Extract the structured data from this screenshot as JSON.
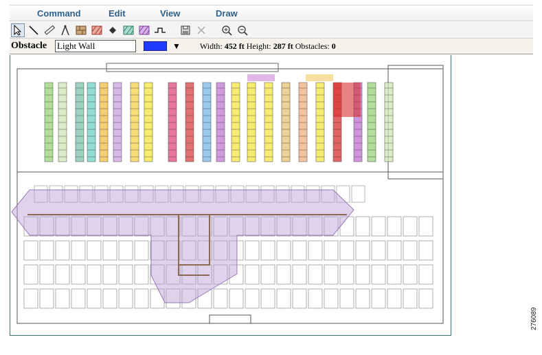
{
  "menu": [
    "Command",
    "Edit",
    "View",
    "Draw"
  ],
  "toolbar": {
    "tools": [
      "select-arrow",
      "line",
      "ruler",
      "compass",
      "wall-pattern",
      "hatch-pattern",
      "diamond",
      "green-pattern",
      "purple-pattern",
      "step-line",
      "save",
      "delete",
      "zoom-in",
      "zoom-out"
    ]
  },
  "properties": {
    "label": "Obstacle",
    "obstacle_type": "Light Wall",
    "obstacle_color": "#1f3cff",
    "width_label": "Width:",
    "width_value": "452 ft",
    "height_label": "Height:",
    "height_value": "287 ft",
    "obstacles_label": "Obstacles:",
    "obstacles_value": "0"
  },
  "colors": {
    "menu_text": "#2f5f86",
    "coverage_zone": "#b79bd1",
    "highlight_red": "#d93030",
    "highlight_yellow": "#f2e640"
  },
  "watermark": "276089"
}
